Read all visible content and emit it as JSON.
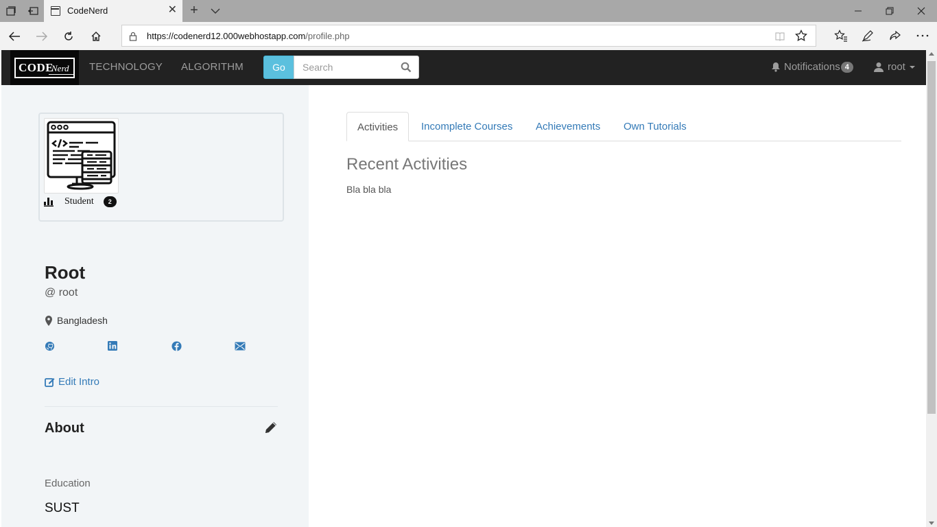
{
  "browser": {
    "tab_title": "CodeNerd",
    "url_host": "https://codenerd12.000webhostapp.com",
    "url_path": "/profile.php"
  },
  "navbar": {
    "brand_code": "CODE",
    "brand_nerd": "Nerd",
    "links": [
      "TECHNOLOGY",
      "ALGORITHM"
    ],
    "go_label": "Go",
    "search_placeholder": "Search",
    "notifications_label": "Notifications",
    "notifications_count": "4",
    "user_label": "root"
  },
  "profile": {
    "role": "Student",
    "role_level": "2",
    "name": "Root",
    "handle": "@ root",
    "location": "Bangladesh",
    "edit_intro_label": "Edit Intro",
    "about_title": "About",
    "education_label": "Education",
    "education_value": "SUST"
  },
  "tabs": [
    {
      "label": "Activities",
      "active": true
    },
    {
      "label": "Incomplete Courses",
      "active": false
    },
    {
      "label": "Achievements",
      "active": false
    },
    {
      "label": "Own Tutorials",
      "active": false
    }
  ],
  "activities": {
    "title": "Recent Activities",
    "body": "Bla bla bla"
  },
  "colors": {
    "navbar_bg": "#222222",
    "link_blue": "#337ab7",
    "go_button": "#5bc0de",
    "panel_bg": "#f2f5f7"
  },
  "icons": [
    "github-icon",
    "linkedin-icon",
    "facebook-icon",
    "mail-icon"
  ]
}
